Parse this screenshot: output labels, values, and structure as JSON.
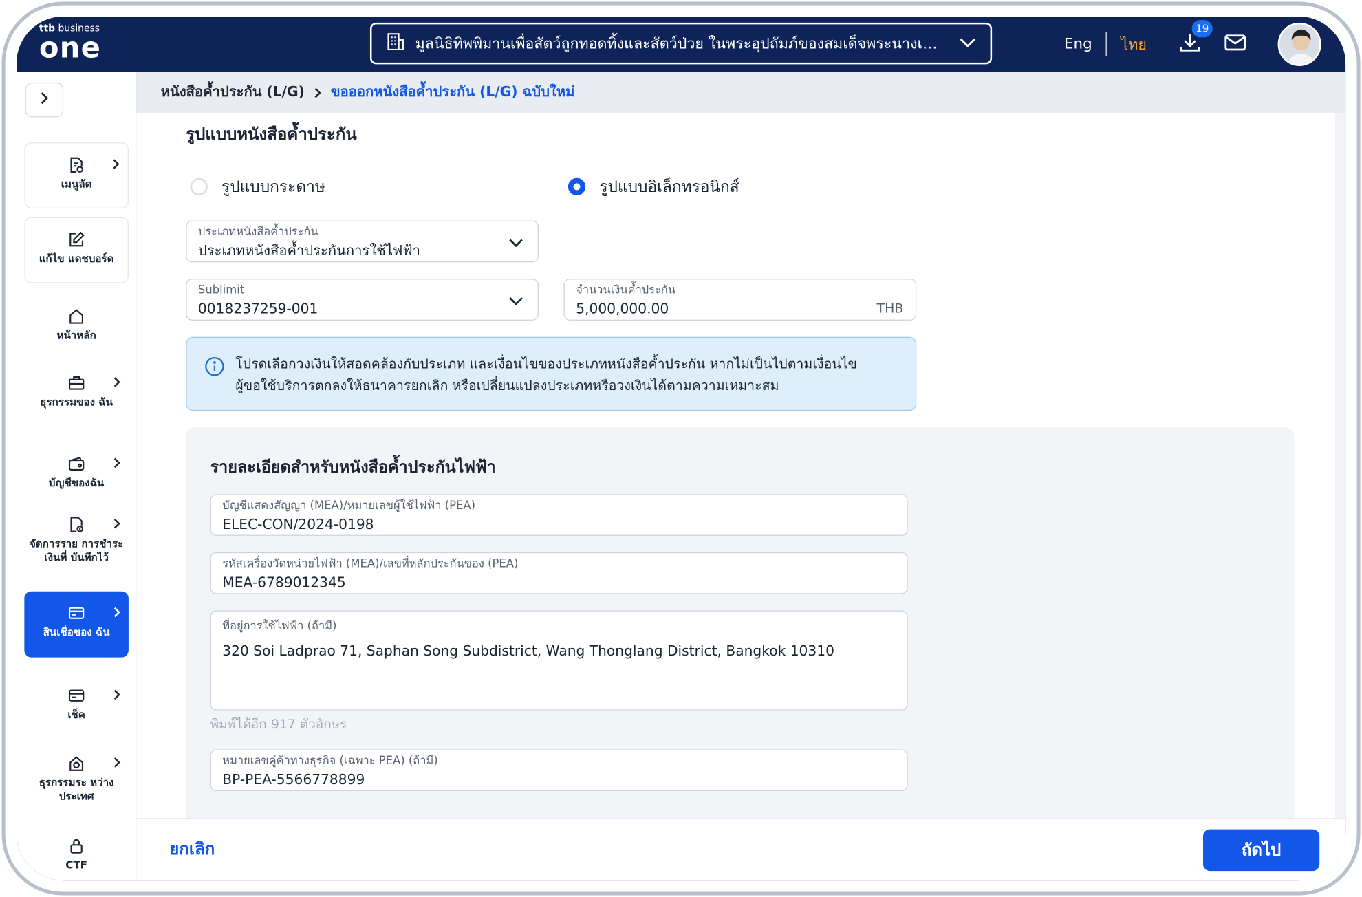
{
  "header": {
    "logo_small_bold": "ttb",
    "logo_small": "business",
    "logo_big": "one",
    "company_name": "มูลนิธิทิพพิมานเพื่อสัตว์ถูกทอดทิ้งและสัตว์ป่วย ในพระอุปถัมภ์ของสมเด็จพระนางเจ้า...",
    "lang_en": "Eng",
    "lang_th": "ไทย",
    "download_badge": "19",
    "icons": [
      "building-icon",
      "chevron-down-icon",
      "download-icon",
      "mail-icon"
    ]
  },
  "sidebar": {
    "items": [
      {
        "label": "เมนูลัด",
        "icon": "shortcut-doc-icon"
      },
      {
        "label": "แก้ไข แดชบอร์ด",
        "icon": "edit-icon"
      },
      {
        "label": "หน้าหลัก",
        "icon": "home-icon"
      },
      {
        "label": "ธุรกรรมของ ฉัน",
        "icon": "briefcase-icon"
      },
      {
        "label": "บัญชีของฉัน",
        "icon": "wallet-icon"
      },
      {
        "label": "จัดการราย การชำระเงินที่ บันทึกไว้",
        "icon": "saved-payment-icon"
      },
      {
        "label": "สินเชื่อของ ฉัน",
        "icon": "loan-card-icon",
        "active": true
      },
      {
        "label": "เช็ค",
        "icon": "cheque-icon"
      },
      {
        "label": "ธุรกรรมระ หว่างประเทศ",
        "icon": "international-icon"
      },
      {
        "label": "CTF",
        "icon": "lock-icon"
      }
    ]
  },
  "breadcrumb": {
    "first": "หนังสือค้ำประกัน (L/G)",
    "current": "ขอออกหนังสือค้ำประกัน (L/G) ฉบับใหม่"
  },
  "form": {
    "section_title": "รูปแบบหนังสือค้ำประกัน",
    "radio_paper": "รูปแบบกระดาษ",
    "radio_electronic": "รูปแบบอิเล็กทรอนิกส์",
    "selected_format": "electronic",
    "lg_type_label": "ประเภทหนังสือค้ำประกัน",
    "lg_type_value": "ประเภทหนังสือค้ำประกันการใช้ไฟฟ้า",
    "sublimit_label": "Sublimit",
    "sublimit_value": "0018237259-001",
    "amount_label": "จำนวนเงินค้ำประกัน",
    "amount_value": "5,000,000.00",
    "amount_unit": "THB",
    "info_line1": "โปรดเลือกวงเงินให้สอดคล้องกับประเภท และเงื่อนไขของประเภทหนังสือค้ำประกัน หากไม่เป็นไปตามเงื่อนไข",
    "info_line2": "ผู้ขอใช้บริการตกลงให้ธนาคารยกเลิก หรือเปลี่ยนแปลงประเภทหรือวงเงินได้ตามความเหมาะสม"
  },
  "details": {
    "title": "รายละเอียดสำหรับหนังสือค้ำประกันไฟฟ้า",
    "contract_label": "บัญชีแสดงสัญญา (MEA)/หมายเลขผู้ใช้ไฟฟ้า (PEA)",
    "contract_value": "ELEC-CON/2024-0198",
    "meter_label": "รหัสเครื่องวัดหน่วยไฟฟ้า (MEA)/เลขที่หลักประกันของ (PEA)",
    "meter_value": "MEA-6789012345",
    "address_label": "ที่อยู่การใช้ไฟฟ้า (ถ้ามี)",
    "address_value": "320 Soi Ladprao 71, Saphan Song Subdistrict, Wang Thonglang District, Bangkok 10310",
    "counter": "พิมพ์ได้อีก 917 ตัวอักษร",
    "bp_label": "หมายเลขคู่ค้าทางธุรกิจ (เฉพาะ PEA) (ถ้ามี)",
    "bp_value": "BP-PEA-5566778899"
  },
  "footer": {
    "cancel": "ยกเลิก",
    "next": "ถัดไป"
  },
  "colors": {
    "header_bg": "#0e2459",
    "primary": "#1257e8",
    "lang_active": "#f4a43a",
    "info_bg": "#dfeefb",
    "panel_bg": "#f3f4f7"
  }
}
